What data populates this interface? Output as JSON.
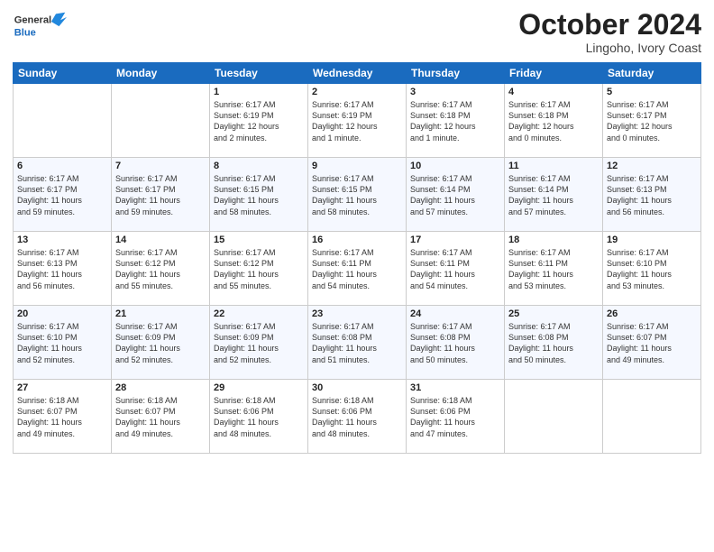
{
  "logo": {
    "line1": "General",
    "line2": "Blue"
  },
  "title": "October 2024",
  "subtitle": "Lingoho, Ivory Coast",
  "weekdays": [
    "Sunday",
    "Monday",
    "Tuesday",
    "Wednesday",
    "Thursday",
    "Friday",
    "Saturday"
  ],
  "weeks": [
    [
      {
        "day": "",
        "info": ""
      },
      {
        "day": "",
        "info": ""
      },
      {
        "day": "1",
        "info": "Sunrise: 6:17 AM\nSunset: 6:19 PM\nDaylight: 12 hours\nand 2 minutes."
      },
      {
        "day": "2",
        "info": "Sunrise: 6:17 AM\nSunset: 6:19 PM\nDaylight: 12 hours\nand 1 minute."
      },
      {
        "day": "3",
        "info": "Sunrise: 6:17 AM\nSunset: 6:18 PM\nDaylight: 12 hours\nand 1 minute."
      },
      {
        "day": "4",
        "info": "Sunrise: 6:17 AM\nSunset: 6:18 PM\nDaylight: 12 hours\nand 0 minutes."
      },
      {
        "day": "5",
        "info": "Sunrise: 6:17 AM\nSunset: 6:17 PM\nDaylight: 12 hours\nand 0 minutes."
      }
    ],
    [
      {
        "day": "6",
        "info": "Sunrise: 6:17 AM\nSunset: 6:17 PM\nDaylight: 11 hours\nand 59 minutes."
      },
      {
        "day": "7",
        "info": "Sunrise: 6:17 AM\nSunset: 6:17 PM\nDaylight: 11 hours\nand 59 minutes."
      },
      {
        "day": "8",
        "info": "Sunrise: 6:17 AM\nSunset: 6:15 PM\nDaylight: 11 hours\nand 58 minutes."
      },
      {
        "day": "9",
        "info": "Sunrise: 6:17 AM\nSunset: 6:15 PM\nDaylight: 11 hours\nand 58 minutes."
      },
      {
        "day": "10",
        "info": "Sunrise: 6:17 AM\nSunset: 6:14 PM\nDaylight: 11 hours\nand 57 minutes."
      },
      {
        "day": "11",
        "info": "Sunrise: 6:17 AM\nSunset: 6:14 PM\nDaylight: 11 hours\nand 57 minutes."
      },
      {
        "day": "12",
        "info": "Sunrise: 6:17 AM\nSunset: 6:13 PM\nDaylight: 11 hours\nand 56 minutes."
      }
    ],
    [
      {
        "day": "13",
        "info": "Sunrise: 6:17 AM\nSunset: 6:13 PM\nDaylight: 11 hours\nand 56 minutes."
      },
      {
        "day": "14",
        "info": "Sunrise: 6:17 AM\nSunset: 6:12 PM\nDaylight: 11 hours\nand 55 minutes."
      },
      {
        "day": "15",
        "info": "Sunrise: 6:17 AM\nSunset: 6:12 PM\nDaylight: 11 hours\nand 55 minutes."
      },
      {
        "day": "16",
        "info": "Sunrise: 6:17 AM\nSunset: 6:11 PM\nDaylight: 11 hours\nand 54 minutes."
      },
      {
        "day": "17",
        "info": "Sunrise: 6:17 AM\nSunset: 6:11 PM\nDaylight: 11 hours\nand 54 minutes."
      },
      {
        "day": "18",
        "info": "Sunrise: 6:17 AM\nSunset: 6:11 PM\nDaylight: 11 hours\nand 53 minutes."
      },
      {
        "day": "19",
        "info": "Sunrise: 6:17 AM\nSunset: 6:10 PM\nDaylight: 11 hours\nand 53 minutes."
      }
    ],
    [
      {
        "day": "20",
        "info": "Sunrise: 6:17 AM\nSunset: 6:10 PM\nDaylight: 11 hours\nand 52 minutes."
      },
      {
        "day": "21",
        "info": "Sunrise: 6:17 AM\nSunset: 6:09 PM\nDaylight: 11 hours\nand 52 minutes."
      },
      {
        "day": "22",
        "info": "Sunrise: 6:17 AM\nSunset: 6:09 PM\nDaylight: 11 hours\nand 52 minutes."
      },
      {
        "day": "23",
        "info": "Sunrise: 6:17 AM\nSunset: 6:08 PM\nDaylight: 11 hours\nand 51 minutes."
      },
      {
        "day": "24",
        "info": "Sunrise: 6:17 AM\nSunset: 6:08 PM\nDaylight: 11 hours\nand 50 minutes."
      },
      {
        "day": "25",
        "info": "Sunrise: 6:17 AM\nSunset: 6:08 PM\nDaylight: 11 hours\nand 50 minutes."
      },
      {
        "day": "26",
        "info": "Sunrise: 6:17 AM\nSunset: 6:07 PM\nDaylight: 11 hours\nand 49 minutes."
      }
    ],
    [
      {
        "day": "27",
        "info": "Sunrise: 6:18 AM\nSunset: 6:07 PM\nDaylight: 11 hours\nand 49 minutes."
      },
      {
        "day": "28",
        "info": "Sunrise: 6:18 AM\nSunset: 6:07 PM\nDaylight: 11 hours\nand 49 minutes."
      },
      {
        "day": "29",
        "info": "Sunrise: 6:18 AM\nSunset: 6:06 PM\nDaylight: 11 hours\nand 48 minutes."
      },
      {
        "day": "30",
        "info": "Sunrise: 6:18 AM\nSunset: 6:06 PM\nDaylight: 11 hours\nand 48 minutes."
      },
      {
        "day": "31",
        "info": "Sunrise: 6:18 AM\nSunset: 6:06 PM\nDaylight: 11 hours\nand 47 minutes."
      },
      {
        "day": "",
        "info": ""
      },
      {
        "day": "",
        "info": ""
      }
    ]
  ]
}
